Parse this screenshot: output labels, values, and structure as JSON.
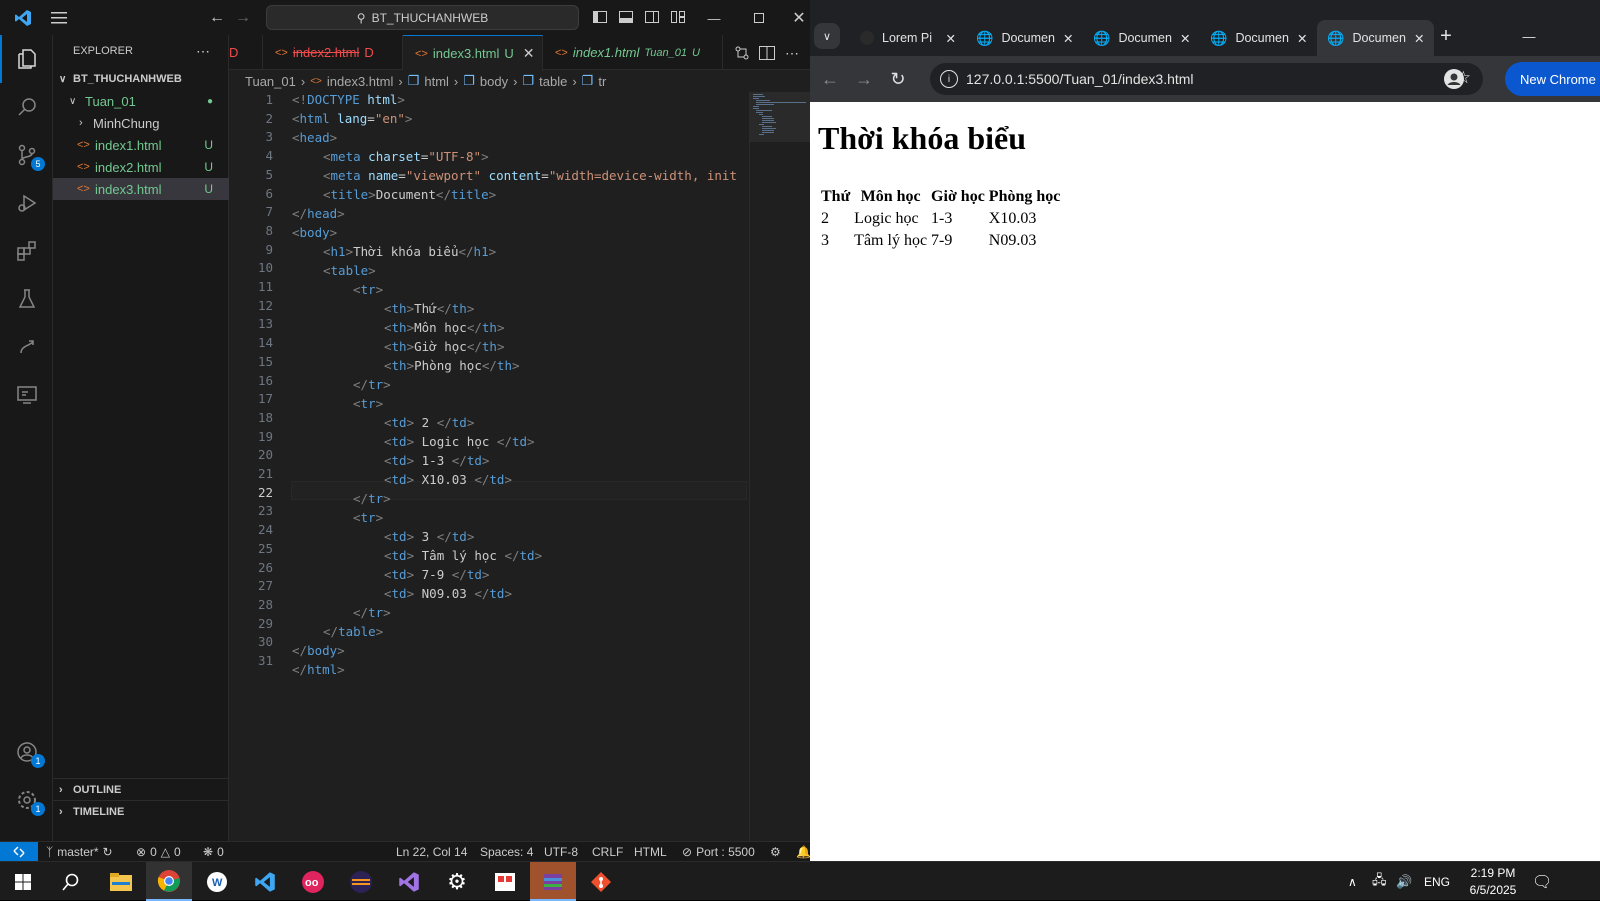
{
  "vscode": {
    "title_search": "BT_THUCHANHWEB",
    "explorer_title": "EXPLORER",
    "project": "BT_THUCHANHWEB",
    "folder": "Tuan_01",
    "subfolder": "MinhChung",
    "files": [
      {
        "name": "index1.html",
        "status": "U"
      },
      {
        "name": "index2.html",
        "status": "U"
      },
      {
        "name": "index3.html",
        "status": "U"
      }
    ],
    "outline_label": "OUTLINE",
    "timeline_label": "TIMELINE",
    "badges": {
      "source_control": "5",
      "accounts": "1",
      "settings": "1"
    },
    "tabs": [
      {
        "label": "D",
        "status": ""
      },
      {
        "label": "index2.html",
        "status": "D"
      },
      {
        "label": "index3.html",
        "status": "U"
      },
      {
        "label": "index1.html",
        "folder": "Tuan_01",
        "status": "U"
      }
    ],
    "breadcrumb": [
      "Tuan_01",
      "index3.html",
      "html",
      "body",
      "table",
      "tr"
    ],
    "line_numbers": [
      "1",
      "2",
      "3",
      "4",
      "5",
      "6",
      "7",
      "8",
      "9",
      "10",
      "11",
      "12",
      "13",
      "14",
      "15",
      "16",
      "17",
      "18",
      "19",
      "20",
      "21",
      "22",
      "23",
      "24",
      "25",
      "26",
      "27",
      "28",
      "29",
      "30",
      "31"
    ],
    "code": {
      "l1": {
        "open": "<!",
        "kw": "DOCTYPE",
        "name": "html",
        "close": ">"
      },
      "l2": {
        "open": "<",
        "tag": "html",
        "attr": "lang",
        "eq": "=",
        "val": "\"en\"",
        "close": ">"
      },
      "l3": {
        "open": "<",
        "tag": "head",
        "close": ">"
      },
      "l4": {
        "open": "<",
        "tag": "meta",
        "attr": "charset",
        "eq": "=",
        "val": "\"UTF-8\"",
        "close": ">"
      },
      "l5": {
        "open": "<",
        "tag": "meta",
        "attr1": "name",
        "eq1": "=",
        "val1": "\"viewport\"",
        "attr2": "content",
        "eq2": "=",
        "val2": "\"width=device-width, init"
      },
      "l6": {
        "open": "<",
        "tag": "title",
        "close": ">",
        "text": "Document",
        "eopen": "</",
        "etag": "title",
        "eclose": ">"
      },
      "l7": {
        "open": "</",
        "tag": "head",
        "close": ">"
      },
      "l8": {
        "open": "<",
        "tag": "body",
        "close": ">"
      },
      "l9": {
        "open": "<",
        "tag": "h1",
        "close": ">",
        "text": "Thời khóa biểu",
        "eopen": "</",
        "etag": "h1",
        "eclose": ">"
      },
      "l10": {
        "open": "<",
        "tag": "table",
        "close": ">"
      },
      "l11": {
        "open": "<",
        "tag": "tr",
        "close": ">"
      },
      "l12": {
        "open": "<",
        "tag": "th",
        "close": ">",
        "text": "Thứ",
        "eopen": "</",
        "etag": "th",
        "eclose": ">"
      },
      "l13": {
        "open": "<",
        "tag": "th",
        "close": ">",
        "text": "Môn học",
        "eopen": "</",
        "etag": "th",
        "eclose": ">"
      },
      "l14": {
        "open": "<",
        "tag": "th",
        "close": ">",
        "text": "Giờ học",
        "eopen": "</",
        "etag": "th",
        "eclose": ">"
      },
      "l15": {
        "open": "<",
        "tag": "th",
        "close": ">",
        "text": "Phòng học",
        "eopen": "</",
        "etag": "th",
        "eclose": ">"
      },
      "l16": {
        "open": "</",
        "tag": "tr",
        "close": ">"
      },
      "l17": {
        "open": "<",
        "tag": "tr",
        "close": ">"
      },
      "l18": {
        "open": "<",
        "tag": "td",
        "close": ">",
        "text": " 2 ",
        "eopen": "</",
        "etag": "td",
        "eclose": ">"
      },
      "l19": {
        "open": "<",
        "tag": "td",
        "close": ">",
        "text": " Logic học ",
        "eopen": "</",
        "etag": "td",
        "eclose": ">"
      },
      "l20": {
        "open": "<",
        "tag": "td",
        "close": ">",
        "text": " 1-3 ",
        "eopen": "</",
        "etag": "td",
        "eclose": ">"
      },
      "l21": {
        "open": "<",
        "tag": "td",
        "close": ">",
        "text": " X10.03 ",
        "eopen": "</",
        "etag": "td",
        "eclose": ">"
      },
      "l22": {
        "open": "</",
        "tag": "tr",
        "close": ">"
      },
      "l23": {
        "open": "<",
        "tag": "tr",
        "close": ">"
      },
      "l24": {
        "open": "<",
        "tag": "td",
        "close": ">",
        "text": " 3 ",
        "eopen": "</",
        "etag": "td",
        "eclose": ">"
      },
      "l25": {
        "open": "<",
        "tag": "td",
        "close": ">",
        "text": " Tâm lý học ",
        "eopen": "</",
        "etag": "td",
        "eclose": ">"
      },
      "l26": {
        "open": "<",
        "tag": "td",
        "close": ">",
        "text": " 7-9 ",
        "eopen": "</",
        "etag": "td",
        "eclose": ">"
      },
      "l27": {
        "open": "<",
        "tag": "td",
        "close": ">",
        "text": " N09.03 ",
        "eopen": "</",
        "etag": "td",
        "eclose": ">"
      },
      "l28": {
        "open": "</",
        "tag": "tr",
        "close": ">"
      },
      "l29": {
        "open": "</",
        "tag": "table",
        "close": ">"
      },
      "l30": {
        "open": "</",
        "tag": "body",
        "close": ">"
      },
      "l31": {
        "open": "</",
        "tag": "html",
        "close": ">"
      }
    },
    "status": {
      "branch": "master*",
      "errors": "0",
      "warnings": "0",
      "ports": "0",
      "position": "Ln 22, Col 14",
      "spaces": "Spaces: 4",
      "encoding": "UTF-8",
      "eol": "CRLF",
      "language": "HTML",
      "port": "Port : 5500"
    },
    "colors": {
      "accent": "#0078d4",
      "untracked": "#73c991",
      "deleted": "#f14c4c"
    }
  },
  "chrome": {
    "tabs": [
      "Lorem Pi",
      "Documen",
      "Documen",
      "Documen",
      "Documen"
    ],
    "url": "127.0.0.1:5500/Tuan_01/index3.html",
    "new_chrome": "New Chrome a",
    "page": {
      "heading": "Thời khóa biểu",
      "headers": [
        "Thứ",
        "Môn học",
        "Giờ học",
        "Phòng học"
      ],
      "rows": [
        [
          "2",
          "Logic học",
          "1-3",
          "X10.03"
        ],
        [
          "3",
          "Tâm lý học",
          "7-9",
          "N09.03"
        ]
      ]
    }
  },
  "taskbar": {
    "language": "ENG",
    "time": "2:19 PM",
    "date": "6/5/2025"
  }
}
